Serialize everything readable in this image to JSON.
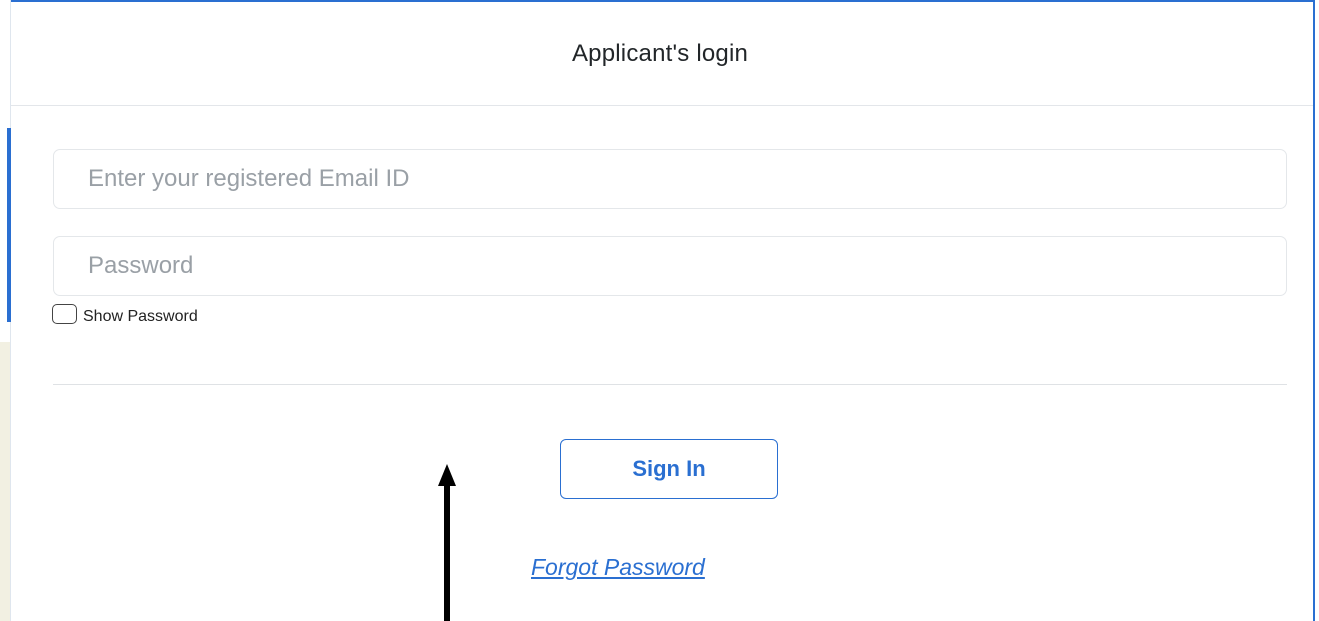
{
  "dialog": {
    "title": "Applicant's login"
  },
  "form": {
    "email_placeholder": "Enter your registered Email ID",
    "email_value": "",
    "password_placeholder": "Password",
    "password_value": "",
    "show_password_label": "Show Password",
    "show_password_checked": false,
    "signin_label": "Sign In",
    "forgot_label": "Forgot Password"
  },
  "colors": {
    "accent": "#2a6fd1",
    "border": "#e4e7ea",
    "title_text": "#222629",
    "placeholder_text": "#9aa0a6",
    "annotation_arrow": "#000000"
  },
  "icons": {
    "annotation": "up-arrow-icon",
    "checkbox": "checkbox-icon"
  }
}
